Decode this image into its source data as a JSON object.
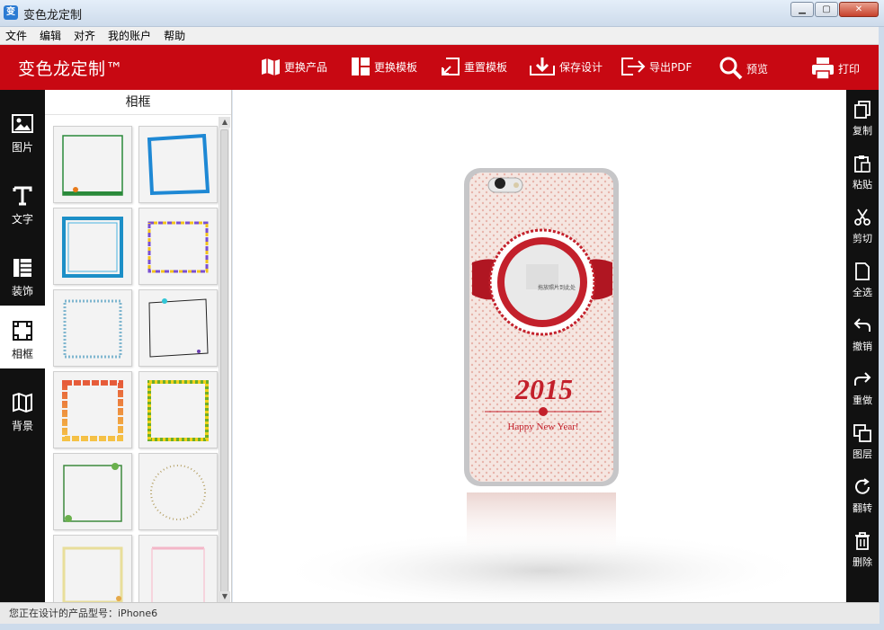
{
  "window": {
    "title": "变色龙定制"
  },
  "menu": {
    "items": [
      "文件",
      "编辑",
      "对齐",
      "我的账户",
      "帮助"
    ]
  },
  "toolbar": {
    "brand": "变色龙定制™",
    "buttons": [
      {
        "label": "更换产品",
        "icon": "map-icon"
      },
      {
        "label": "更换模板",
        "icon": "layout-icon"
      },
      {
        "label": "重置模板",
        "icon": "reset-icon"
      },
      {
        "label": "保存设计",
        "icon": "save-icon"
      },
      {
        "label": "导出PDF",
        "icon": "export-icon"
      },
      {
        "label": "预览",
        "icon": "magnifier-icon"
      },
      {
        "label": "打印",
        "icon": "printer-icon"
      }
    ]
  },
  "sidebar": {
    "items": [
      {
        "label": "图片",
        "icon": "image-icon"
      },
      {
        "label": "文字",
        "icon": "text-icon"
      },
      {
        "label": "装饰",
        "icon": "decoration-icon"
      },
      {
        "label": "相框",
        "icon": "frame-icon",
        "active": true
      },
      {
        "label": "背景",
        "icon": "background-icon"
      }
    ]
  },
  "panel": {
    "title": "相框"
  },
  "canvas": {
    "phone_year": "2015",
    "phone_greeting": "Happy New Year!",
    "phone_placeholder": "拖放照片到此处"
  },
  "rightbar": {
    "items": [
      {
        "label": "复制",
        "icon": "copy-icon"
      },
      {
        "label": "粘贴",
        "icon": "paste-icon"
      },
      {
        "label": "剪切",
        "icon": "scissors-icon"
      },
      {
        "label": "全选",
        "icon": "select-all-icon"
      },
      {
        "label": "撤销",
        "icon": "undo-icon"
      },
      {
        "label": "重做",
        "icon": "redo-icon"
      },
      {
        "label": "图层",
        "icon": "layers-icon"
      },
      {
        "label": "翻转",
        "icon": "rotate-icon"
      },
      {
        "label": "删除",
        "icon": "trash-icon"
      }
    ]
  },
  "status": {
    "text": "您正在设计的产品型号：iPhone6"
  },
  "colors": {
    "brand_red": "#c80812",
    "dark_bar": "#111111"
  }
}
